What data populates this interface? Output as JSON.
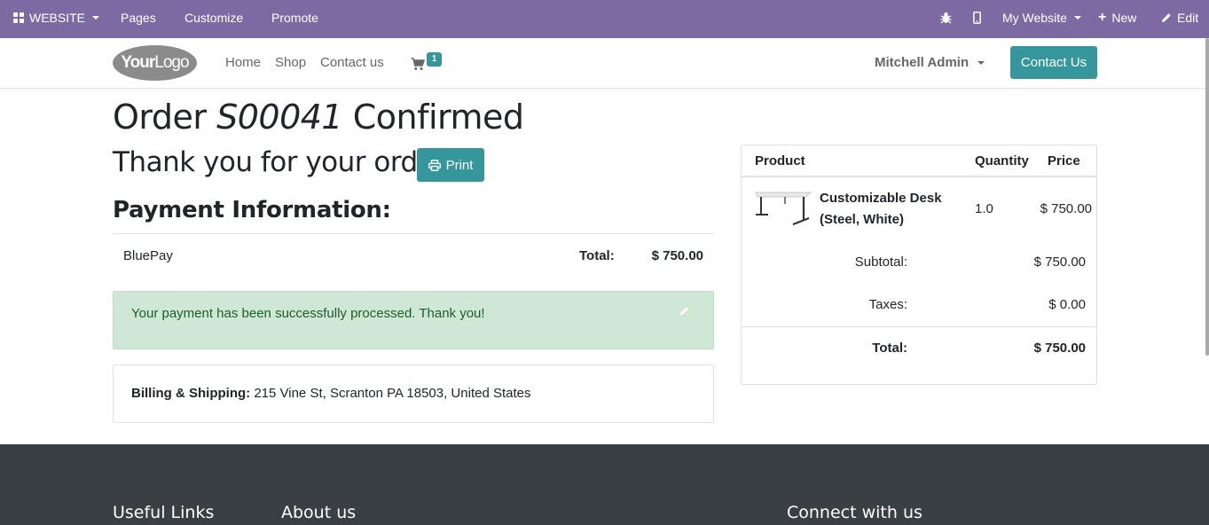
{
  "admin_bar": {
    "website_label": "WEBSITE",
    "pages": "Pages",
    "customize": "Customize",
    "promote": "Promote",
    "my_website": "My Website",
    "new": "New",
    "edit": "Edit",
    "bg_color": "#7c6ba2"
  },
  "navbar": {
    "logo_text_bold": "Your",
    "logo_text": "Logo",
    "links": [
      "Home",
      "Shop",
      "Contact us"
    ],
    "cart_count": "1",
    "user": "Mitchell Admin",
    "contact_button": "Contact Us",
    "accent_color": "#35979c"
  },
  "order": {
    "title_prefix": "Order",
    "order_ref": "S00041",
    "title_suffix": "Confirmed",
    "thanks": "Thank you for your order.",
    "print": "Print"
  },
  "payment": {
    "heading": "Payment Information:",
    "acquirer": "BluePay",
    "total_label": "Total:",
    "total_value": "$ 750.00",
    "success_message": "Your payment has been successfully processed. Thank you!"
  },
  "billing": {
    "label": "Billing & Shipping:",
    "address": "215 Vine St, Scranton PA 18503, United States"
  },
  "summary": {
    "headers": {
      "product": "Product",
      "quantity": "Quantity",
      "price": "Price"
    },
    "line": {
      "name": "Customizable Desk (Steel, White)",
      "qty": "1.0",
      "price": "$ 750.00"
    },
    "subtotal_label": "Subtotal:",
    "subtotal_value": "$ 750.00",
    "taxes_label": "Taxes:",
    "taxes_value": "$ 0.00",
    "total_label": "Total:",
    "total_value": "$ 750.00"
  },
  "footer": {
    "useful_links": "Useful Links",
    "about_us": "About us",
    "connect": "Connect with us"
  }
}
